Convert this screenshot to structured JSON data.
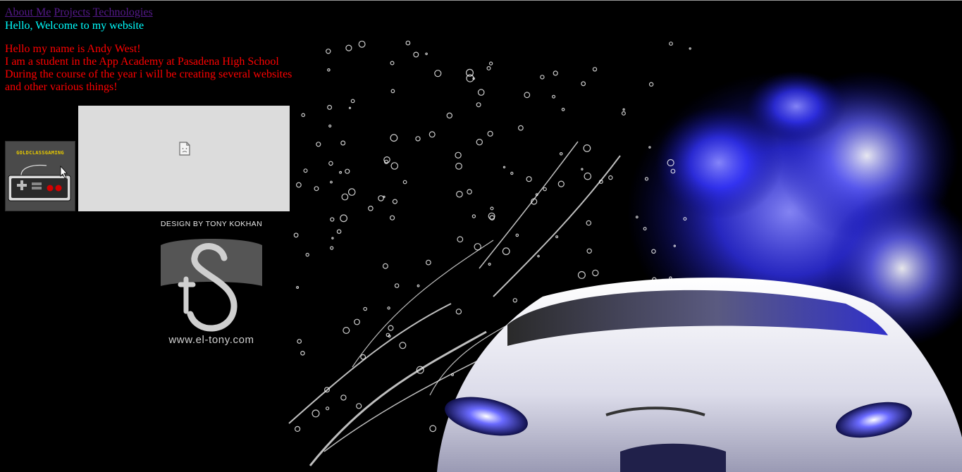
{
  "nav": {
    "links": [
      "About Me",
      "Projects",
      "Technologies"
    ]
  },
  "welcome": "Hello, Welcome to my website",
  "intro": {
    "lines": [
      "Hello my name is Andy West!",
      "I am a student in the App Academy at Pasadena High School",
      "During the course of the year i will be creating several websites",
      "and other various things!"
    ]
  },
  "images": {
    "gold_title": "GOLDCLASSGAMING",
    "broken_icon": "broken-image-icon"
  },
  "logo": {
    "design_by": "DESIGN BY TONY KOKHAN",
    "url": "www.el-tony.com"
  },
  "background": {
    "subject": "car-with-water-splash-and-blue-fire-icon"
  },
  "colors": {
    "background": "#000000",
    "welcome": "#00ffff",
    "intro": "#ff0000",
    "link": "#551a8b",
    "fire": "#3b3bff"
  }
}
